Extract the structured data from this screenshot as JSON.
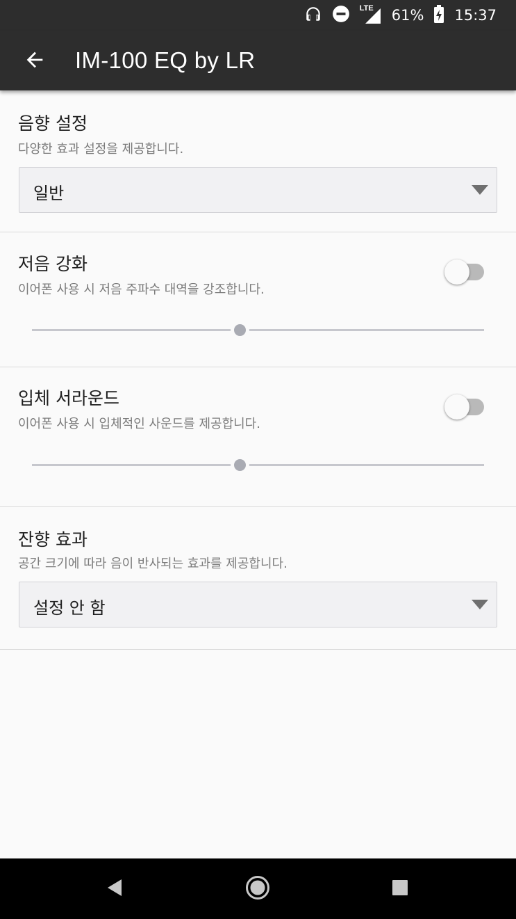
{
  "status_bar": {
    "network": "LTE",
    "battery": "61%",
    "time": "15:37",
    "icons": [
      "headphones-icon",
      "do-not-disturb-icon",
      "signal-icon",
      "battery-charging-icon"
    ]
  },
  "app_bar": {
    "title": "IM-100 EQ by LR",
    "back_icon": "arrow-back-icon"
  },
  "sound_setting": {
    "title": "음향 설정",
    "description": "다양한 효과 설정을 제공합니다.",
    "selected": "일반"
  },
  "bass_boost": {
    "title": "저음 강화",
    "description": "이어폰 사용 시 저음 주파수 대역을 강조합니다.",
    "enabled": false,
    "level": 0.46
  },
  "surround": {
    "title": "입체 서라운드",
    "description": "이어폰 사용 시 입체적인 사운드를 제공합니다.",
    "enabled": false,
    "level": 0.46
  },
  "reverb": {
    "title": "잔향 효과",
    "description": "공간 크기에 따라 음이 반사되는 효과를 제공합니다.",
    "selected": "설정 안 함"
  },
  "nav_bar": {
    "icons": [
      "back-icon",
      "home-icon",
      "recents-icon"
    ]
  },
  "colors": {
    "app_bar": "#2d2d2d",
    "background": "#fafafa",
    "nav_bar": "#000000",
    "slider_thumb": "#a9abb3"
  }
}
